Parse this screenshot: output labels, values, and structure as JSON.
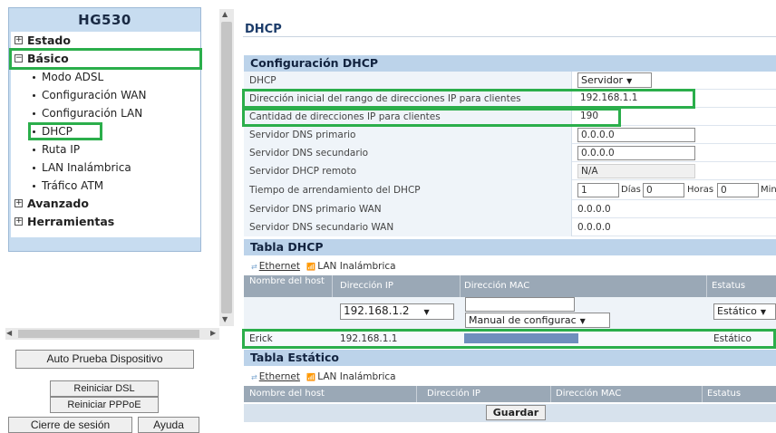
{
  "sidebar": {
    "brand": "HG530",
    "menu": [
      {
        "label": "Estado",
        "expander": "+"
      },
      {
        "label": "Básico",
        "expander": "−"
      },
      {
        "label": "Modo ADSL"
      },
      {
        "label": "Configuración WAN"
      },
      {
        "label": "Configuración LAN"
      },
      {
        "label": "DHCP"
      },
      {
        "label": "Ruta IP"
      },
      {
        "label": "LAN Inalámbrica"
      },
      {
        "label": "Tráfico ATM"
      },
      {
        "label": "Avanzado",
        "expander": "+"
      },
      {
        "label": "Herramientas",
        "expander": "+"
      }
    ],
    "buttons": {
      "auto_test": "Auto Prueba Dispositivo",
      "restart_dsl": "Reiniciar DSL",
      "restart_pppoe": "Reiniciar PPPoE",
      "logout": "Cierre de sesión",
      "help": "Ayuda"
    }
  },
  "page": {
    "title": "DHCP"
  },
  "dhcp_config": {
    "heading": "Configuración DHCP",
    "rows": [
      {
        "label": "DHCP",
        "value": "Servidor"
      },
      {
        "label": "Dirección inicial del rango de direcciones IP para clientes",
        "value": "192.168.1.1"
      },
      {
        "label": "Cantidad de direcciones IP para clientes",
        "value": "190"
      },
      {
        "label": "Servidor DNS primario",
        "value": "0.0.0.0"
      },
      {
        "label": "Servidor DNS secundario",
        "value": "0.0.0.0"
      },
      {
        "label": "Servidor DHCP remoto",
        "value": "N/A"
      },
      {
        "label": "Tiempo de arrendamiento del DHCP",
        "days": "1",
        "days_unit": "Días",
        "hours": "0",
        "hours_unit": "Horas",
        "minutes": "0",
        "minutes_unit": "Min"
      },
      {
        "label": "Servidor DNS primario WAN",
        "value": "0.0.0.0"
      },
      {
        "label": "Servidor DNS secundario WAN",
        "value": "0.0.0.0"
      }
    ]
  },
  "dhcp_table": {
    "heading": "Tabla DHCP",
    "tab_ethernet": "Ethernet",
    "tab_wlan": "LAN Inalámbrica",
    "columns": [
      "Nombre del host",
      "Dirección IP",
      "Dirección MAC",
      "Estatus"
    ],
    "input_row": {
      "ip": "192.168.1.2",
      "mac_mode": "Manual de configurac",
      "status": "Estático"
    },
    "rows": [
      {
        "host": "Erick",
        "ip": "192.168.1.1",
        "mac": "",
        "status": "Estático"
      }
    ]
  },
  "static_table": {
    "heading": "Tabla Estático",
    "tab_ethernet": "Ethernet",
    "tab_wlan": "LAN Inalámbrica",
    "columns": [
      "Nombre del host",
      "Dirección IP",
      "Dirección MAC",
      "Estatus"
    ]
  },
  "save_label": "Guardar",
  "colors": {
    "highlight": "#2bae4b",
    "section_header": "#bcd3ea",
    "sidebar": "#c7dcf0",
    "table_header": "#9aa8b6",
    "mac_redacted": "#6f8fbd"
  }
}
